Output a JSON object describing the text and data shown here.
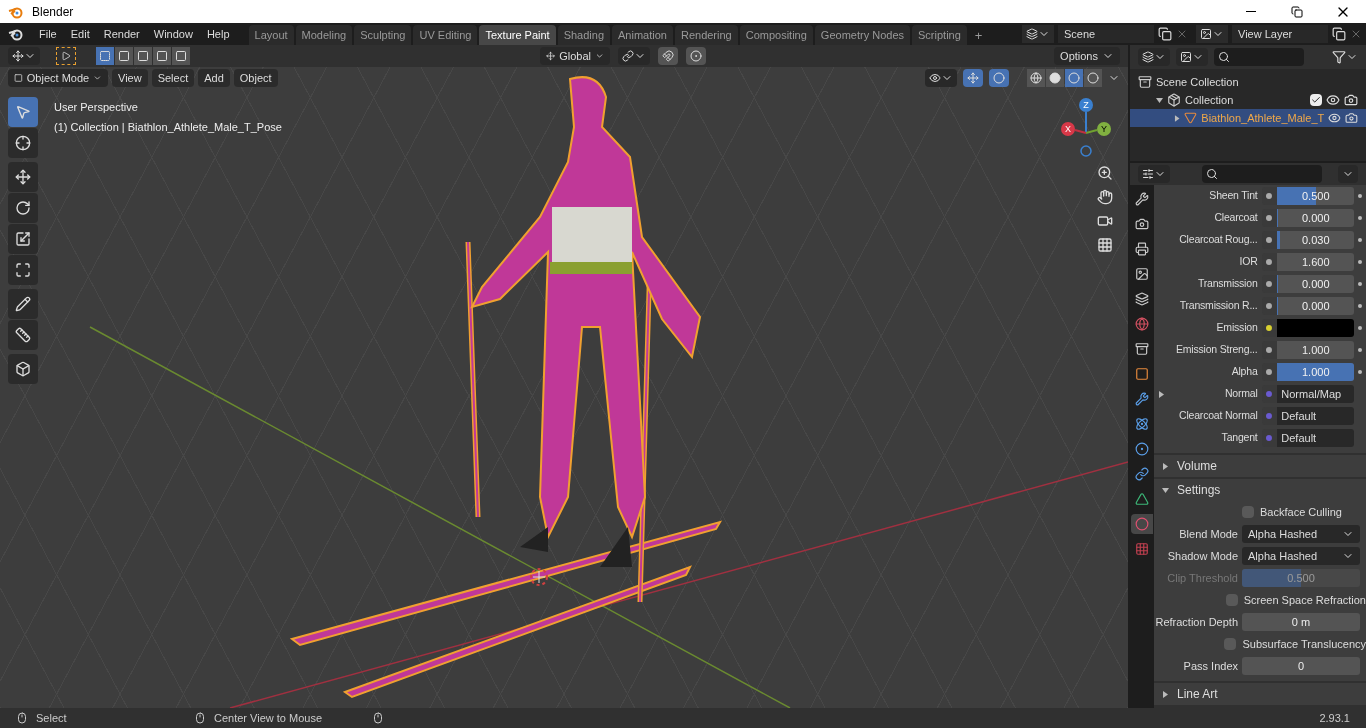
{
  "window": {
    "title": "Blender"
  },
  "menu": [
    "File",
    "Edit",
    "Render",
    "Window",
    "Help"
  ],
  "workspaces": [
    {
      "label": "Layout",
      "selected": false
    },
    {
      "label": "Modeling",
      "selected": false
    },
    {
      "label": "Sculpting",
      "selected": false
    },
    {
      "label": "UV Editing",
      "selected": false
    },
    {
      "label": "Texture Paint",
      "selected": true
    },
    {
      "label": "Shading",
      "selected": false
    },
    {
      "label": "Animation",
      "selected": false
    },
    {
      "label": "Rendering",
      "selected": false
    },
    {
      "label": "Compositing",
      "selected": false
    },
    {
      "label": "Geometry Nodes",
      "selected": false
    },
    {
      "label": "Scripting",
      "selected": false
    }
  ],
  "add_workspace": "+",
  "scene": "Scene",
  "view_layer": "View Layer",
  "tool_header": {
    "selection_modes": [
      {
        "kind": "new",
        "selected": true
      },
      {
        "kind": "extend",
        "selected": false
      },
      {
        "kind": "subtract",
        "selected": false
      },
      {
        "kind": "invert",
        "selected": false
      },
      {
        "kind": "intersect",
        "selected": false
      }
    ],
    "orientation": "Global",
    "options": "Options"
  },
  "viewport_header": {
    "mode": "Object Mode",
    "menus": [
      "View",
      "Select",
      "Add",
      "Object"
    ],
    "shading_modes": [
      {
        "kind": "wireframe",
        "selected": false
      },
      {
        "kind": "solid",
        "selected": false
      },
      {
        "kind": "material",
        "selected": true
      },
      {
        "kind": "rendered",
        "selected": false
      }
    ]
  },
  "viewport": {
    "perspective": "User Perspective",
    "object_info": "(1) Collection | Biathlon_Athlete_Male_T_Pose",
    "axes": {
      "x": "X",
      "y": "Y",
      "z": "Z"
    }
  },
  "toolbar": [
    {
      "kind": "select",
      "selected": true
    },
    {
      "kind": "cursor",
      "selected": false
    },
    {
      "kind": "move",
      "selected": false
    },
    {
      "kind": "rotate",
      "selected": false
    },
    {
      "kind": "scale",
      "selected": false
    },
    {
      "kind": "transform",
      "selected": false
    },
    {
      "kind": "annotate",
      "selected": false
    },
    {
      "kind": "measure",
      "selected": false
    },
    {
      "kind": "add-cube",
      "selected": false
    }
  ],
  "outliner": {
    "items": [
      {
        "label": "Scene Collection",
        "kind": "scene",
        "selected": false,
        "children": [
          {
            "label": "Collection",
            "kind": "collection",
            "selected": false,
            "expanded": true,
            "checked": true,
            "children": [
              {
                "label": "Biathlon_Athlete_Male_T",
                "kind": "object",
                "selected": true,
                "expanded": false
              }
            ]
          }
        ]
      }
    ]
  },
  "properties": {
    "tabs": [
      {
        "kind": "tool",
        "selected": false
      },
      {
        "kind": "render",
        "selected": false
      },
      {
        "kind": "output",
        "selected": false
      },
      {
        "kind": "view-layer",
        "selected": false
      },
      {
        "kind": "scene",
        "selected": false
      },
      {
        "kind": "world",
        "selected": false
      },
      {
        "kind": "collection",
        "selected": false
      },
      {
        "kind": "object",
        "selected": false
      },
      {
        "kind": "modifier",
        "selected": false
      },
      {
        "kind": "particles",
        "selected": false
      },
      {
        "kind": "physics",
        "selected": false
      },
      {
        "kind": "constraints",
        "selected": false
      },
      {
        "kind": "data",
        "selected": false
      },
      {
        "kind": "material",
        "selected": true
      },
      {
        "kind": "texture",
        "selected": false
      }
    ],
    "rows": [
      {
        "label": "Sheen Tint",
        "kind": "slider",
        "value": "0.500",
        "level": 0.5
      },
      {
        "label": "Clearcoat",
        "kind": "slider",
        "value": "0.000",
        "level": 0
      },
      {
        "label": "Clearcoat Roug...",
        "kind": "slider",
        "value": "0.030",
        "level": 0.03
      },
      {
        "label": "IOR",
        "kind": "number",
        "value": "1.600"
      },
      {
        "label": "Transmission",
        "kind": "slider",
        "value": "0.000",
        "level": 0
      },
      {
        "label": "Transmission R...",
        "kind": "slider",
        "value": "0.000",
        "level": 0
      },
      {
        "label": "Emission",
        "kind": "color",
        "color": "#000000"
      },
      {
        "label": "Emission Streng...",
        "kind": "number",
        "value": "1.000"
      },
      {
        "label": "Alpha",
        "kind": "slider",
        "value": "1.000",
        "level": 1
      },
      {
        "label": "Normal",
        "kind": "link",
        "value": "Normal/Map",
        "expanded": false
      },
      {
        "label": "Clearcoat Normal",
        "kind": "link",
        "value": "Default"
      },
      {
        "label": "Tangent",
        "kind": "link",
        "value": "Default"
      }
    ],
    "panels": [
      {
        "label": "Volume",
        "expanded": false
      },
      {
        "label": "Settings",
        "expanded": true,
        "rows": [
          {
            "kind": "checkbox",
            "label": "Backface Culling",
            "checked": false,
            "disabled": false
          },
          {
            "kind": "select",
            "label": "Blend Mode",
            "value": "Alpha Hashed",
            "disabled": false
          },
          {
            "kind": "select",
            "label": "Shadow Mode",
            "value": "Alpha Hashed",
            "disabled": false
          },
          {
            "kind": "slider",
            "label": "Clip Threshold",
            "value": "0.500",
            "level": 0.5,
            "disabled": true
          },
          {
            "kind": "checkbox",
            "label": "Screen Space Refraction",
            "checked": false,
            "disabled": false
          },
          {
            "kind": "number",
            "label": "Refraction Depth",
            "value": "0 m",
            "disabled": false
          },
          {
            "kind": "checkbox",
            "label": "Subsurface Translucency",
            "checked": false,
            "disabled": false
          },
          {
            "kind": "number",
            "label": "Pass Index",
            "value": "0",
            "disabled": false
          }
        ]
      },
      {
        "label": "Line Art",
        "expanded": false
      }
    ]
  },
  "status_bar": {
    "hints": [
      "Select",
      "Center View to Mouse"
    ],
    "version": "2.93.1"
  }
}
